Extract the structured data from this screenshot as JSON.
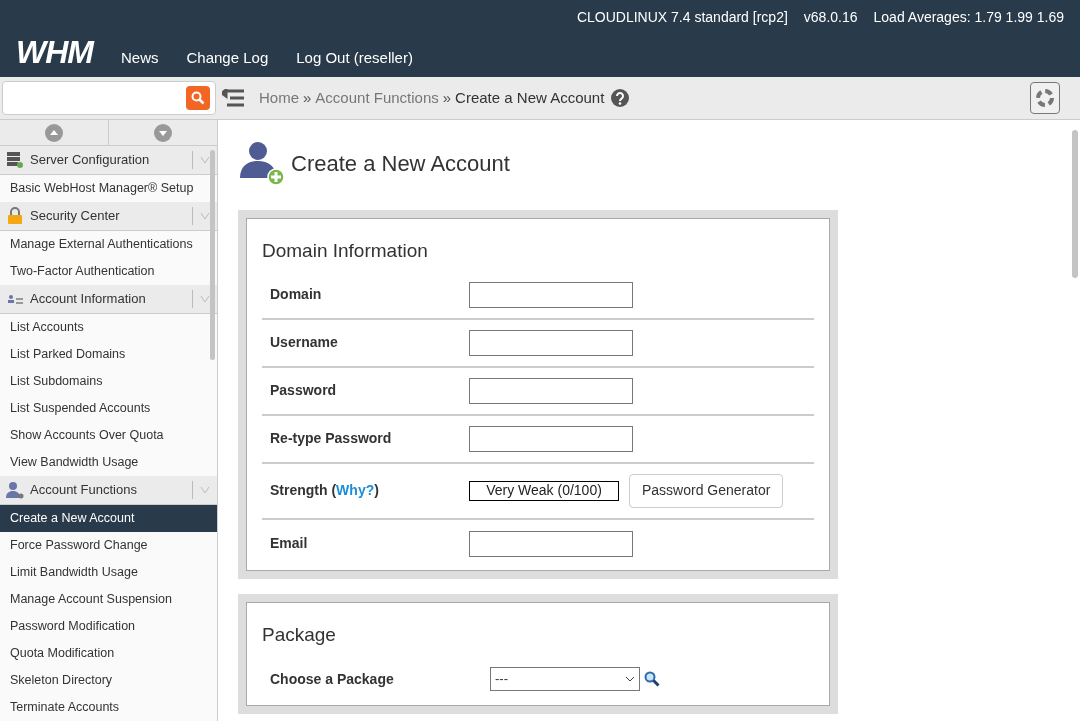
{
  "header": {
    "logo": "WHM",
    "nav": [
      "News",
      "Change Log",
      "Log Out (reseller)"
    ],
    "system_info": [
      "CLOUDLINUX 7.4 standard [rcp2]",
      "v68.0.16",
      "Load Averages: 1.79 1.99 1.69"
    ]
  },
  "toolbar": {
    "breadcrumbs": [
      "Home",
      "Account Functions"
    ],
    "breadcrumb_separator": "»",
    "current": "Create a New Account"
  },
  "sidebar": {
    "sections": [
      {
        "title": "Server Configuration",
        "kind": "server",
        "items": [
          {
            "label": "Basic WebHost Manager® Setup",
            "selected": false
          }
        ]
      },
      {
        "title": "Security Center",
        "kind": "lock",
        "items": [
          {
            "label": "Manage External Authentications",
            "selected": false
          },
          {
            "label": "Two-Factor Authentication",
            "selected": false
          }
        ]
      },
      {
        "title": "Account Information",
        "kind": "card",
        "items": [
          {
            "label": "List Accounts",
            "selected": false
          },
          {
            "label": "List Parked Domains",
            "selected": false
          },
          {
            "label": "List Subdomains",
            "selected": false
          },
          {
            "label": "List Suspended Accounts",
            "selected": false
          },
          {
            "label": "Show Accounts Over Quota",
            "selected": false
          },
          {
            "label": "View Bandwidth Usage",
            "selected": false
          }
        ]
      },
      {
        "title": "Account Functions",
        "kind": "user",
        "items": [
          {
            "label": "Create a New Account",
            "selected": true
          },
          {
            "label": "Force Password Change",
            "selected": false
          },
          {
            "label": "Limit Bandwidth Usage",
            "selected": false
          },
          {
            "label": "Manage Account Suspension",
            "selected": false
          },
          {
            "label": "Password Modification",
            "selected": false
          },
          {
            "label": "Quota Modification",
            "selected": false
          },
          {
            "label": "Skeleton Directory",
            "selected": false
          },
          {
            "label": "Terminate Accounts",
            "selected": false
          }
        ]
      }
    ]
  },
  "page": {
    "title": "Create a New Account",
    "panels": [
      {
        "title": "Domain Information",
        "rows": [
          {
            "kind": "text",
            "label": "Domain"
          },
          {
            "kind": "text",
            "label": "Username"
          },
          {
            "kind": "text",
            "label": "Password"
          },
          {
            "kind": "text",
            "label": "Re-type Password"
          },
          {
            "kind": "strength",
            "label": "Strength (",
            "link": "Why?",
            "label_end": ")",
            "meter": "Very Weak (0/100)",
            "level": 0,
            "button": "Password Generator"
          },
          {
            "kind": "text",
            "label": "Email"
          }
        ]
      },
      {
        "title": "Package",
        "rows": [
          {
            "kind": "select",
            "label": "Choose a Package",
            "value": "---"
          }
        ]
      }
    ]
  }
}
